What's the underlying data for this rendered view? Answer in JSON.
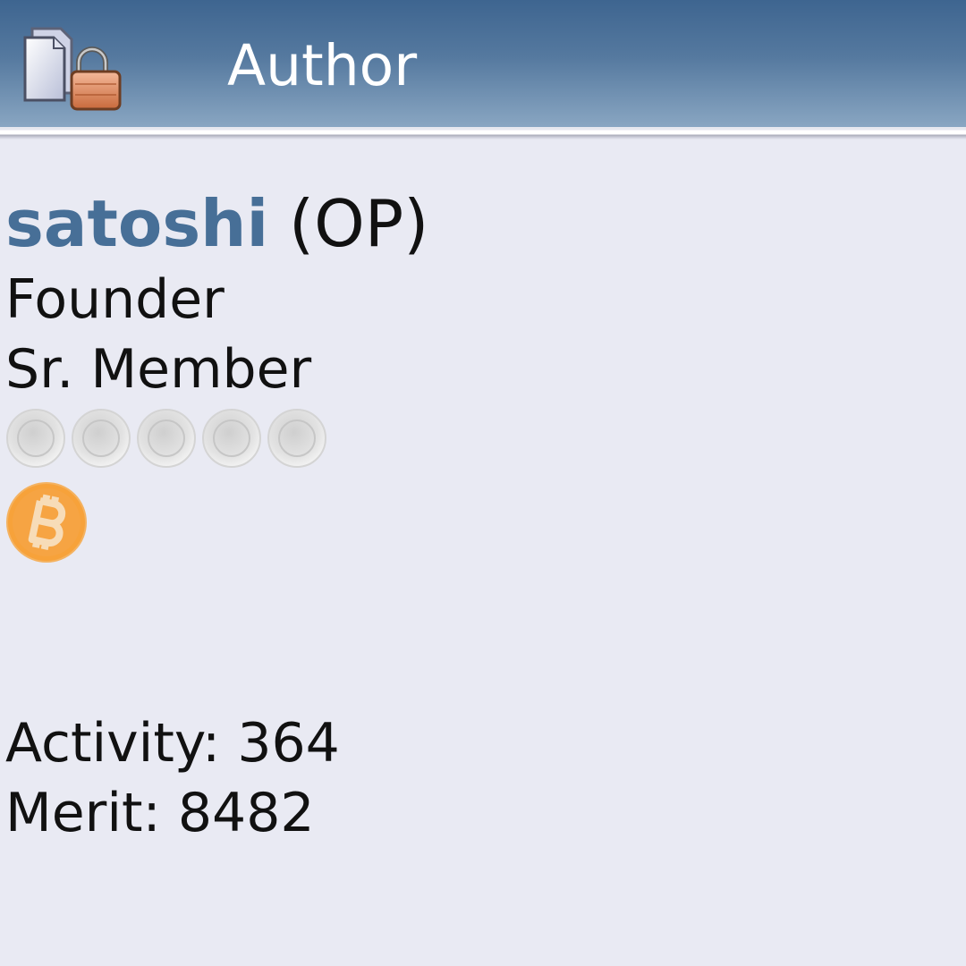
{
  "header": {
    "title": "Author",
    "icon": "locked-topic-icon"
  },
  "author": {
    "username": "satoshi",
    "op_tag": "(OP)",
    "position": "Founder",
    "rank": "Sr. Member",
    "rank_stars": {
      "count": 5,
      "icon": "star-icon",
      "color": "#d8d8d8"
    },
    "badge": {
      "icon": "bitcoin-icon",
      "color": "#f7a23a"
    },
    "activity_label": "Activity:",
    "activity_value": "364",
    "merit_label": "Merit:",
    "merit_value": "8482"
  },
  "colors": {
    "header_top": "#3e6590",
    "header_bottom": "#89a6c2",
    "background": "#e9eaf3",
    "username": "#476f97"
  }
}
